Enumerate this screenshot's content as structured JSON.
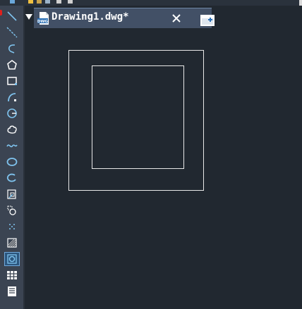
{
  "tab": {
    "title": "Drawing1.dwg*",
    "doc_icon_label": "DWG"
  },
  "icons": {
    "tab_menu": "triangle-down-icon",
    "close": "close-icon",
    "new_tab": "new-tab-icon"
  },
  "toolbar": {
    "tools": [
      {
        "name": "line-tool-icon"
      },
      {
        "name": "construction-line-tool-icon"
      },
      {
        "name": "polyline-tool-icon"
      },
      {
        "name": "polygon-tool-icon"
      },
      {
        "name": "rectangle-tool-icon"
      },
      {
        "name": "arc-tool-icon"
      },
      {
        "name": "circle-tool-icon"
      },
      {
        "name": "revision-cloud-tool-icon"
      },
      {
        "name": "spline-tool-icon"
      },
      {
        "name": "ellipse-tool-icon"
      },
      {
        "name": "ellipse-arc-tool-icon"
      },
      {
        "name": "insert-block-tool-icon"
      },
      {
        "name": "make-block-tool-icon"
      },
      {
        "name": "point-tool-icon"
      },
      {
        "name": "hatch-tool-icon"
      },
      {
        "name": "region-tool-icon",
        "active": true
      },
      {
        "name": "table-tool-icon"
      },
      {
        "name": "multiline-text-tool-icon"
      }
    ]
  },
  "colors": {
    "canvas": "#212830",
    "toolbar": "#3b4452",
    "tab_active": "#425066",
    "accent_blue": "#3fa7e0",
    "geometry_stroke": "#e8e8e8"
  }
}
